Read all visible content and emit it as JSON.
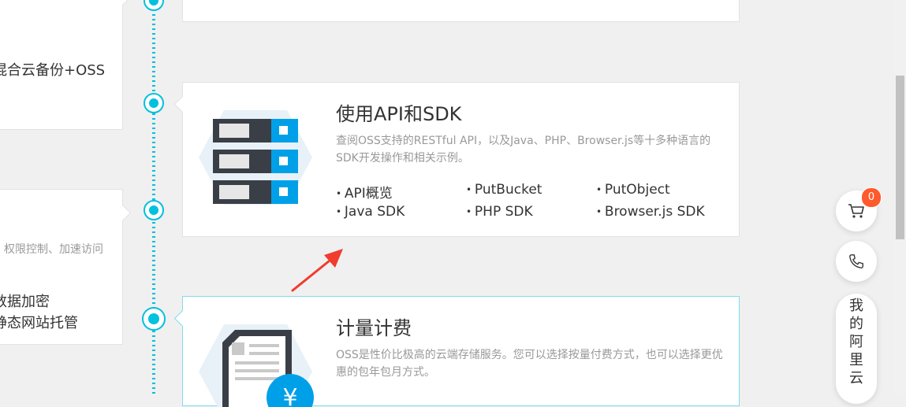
{
  "left_cards": {
    "top": {
      "text": "混合云备份+OSS"
    },
    "mid": {
      "small": "、权限控制、加速访问",
      "line1": "数据加密",
      "line2": "静态网站托管"
    }
  },
  "api_card": {
    "title": "使用API和SDK",
    "desc": "查阅OSS支持的RESTful API，以及Java、PHP、Browser.js等十多种语言的SDK开发操作和相关示例。",
    "links": [
      "API概览",
      "PutBucket",
      "PutObject",
      "Java SDK",
      "PHP SDK",
      "Browser.js SDK"
    ]
  },
  "billing_card": {
    "title": "计量计费",
    "desc": "OSS是性价比极高的云端存储服务。您可以选择按量付费方式，也可以选择更优惠的包年包月方式。"
  },
  "toolbar": {
    "cart_count": "0",
    "aliyun_chars": [
      "我",
      "的",
      "阿",
      "里",
      "云"
    ]
  },
  "colors": {
    "accent": "#00c1de",
    "badge": "#ff5a2c",
    "arrow": "#f03c2e"
  }
}
